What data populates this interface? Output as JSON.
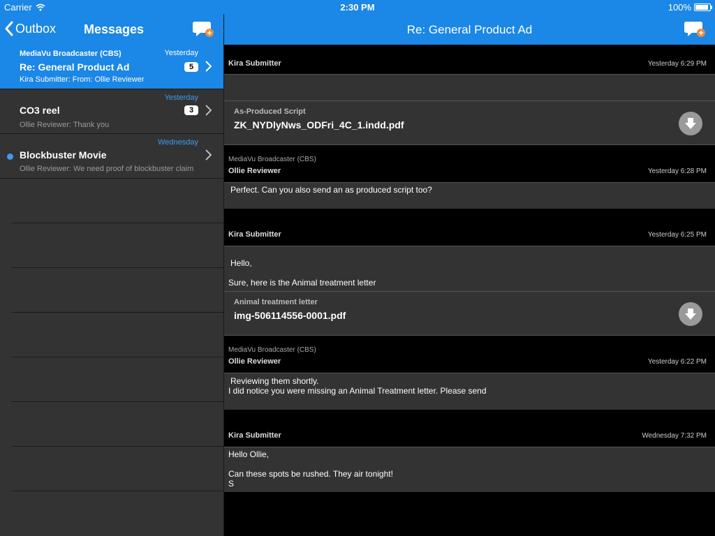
{
  "status_bar": {
    "carrier": "Carrier",
    "time": "2:30 PM",
    "battery": "100%",
    "battery_level": 1.0
  },
  "sidebar": {
    "back_label": "Outbox",
    "title": "Messages",
    "messages": [
      {
        "sender": "MediaVu Broadcaster (CBS)",
        "date": "Yesterday",
        "subject": "Re: General Product Ad",
        "badge": "5",
        "preview": "Kira Submitter: From:    Ollie Reviewer",
        "selected": true,
        "unread": false
      },
      {
        "sender": "",
        "date": "Yesterday",
        "subject": "CO3 reel",
        "badge": "3",
        "preview": "Ollie Reviewer: Thank you",
        "selected": false,
        "unread": false
      },
      {
        "sender": "",
        "date": "Wednesday",
        "subject": "Blockbuster Movie",
        "badge": "",
        "preview": "Ollie Reviewer: We need proof of blockbuster claim",
        "selected": false,
        "unread": true
      }
    ]
  },
  "detail": {
    "title": "Re: General Product Ad",
    "thread": {
      "m1": {
        "name": "Kira Submitter",
        "time": "Yesterday 6:29 PM",
        "attachment_title": "As-Produced Script",
        "attachment_file": "ZK_NYDlyNws_ODFri_4C_1.indd.pdf"
      },
      "m2": {
        "org": "MediaVu Broadcaster (CBS)",
        "name": "Ollie Reviewer",
        "time": "Yesterday 6:28 PM",
        "body": "Perfect. Can you also send an as produced script too?"
      },
      "m3": {
        "name": "Kira Submitter",
        "time": "Yesterday 6:25 PM",
        "body_line1": "Hello,",
        "body_line2": "Sure, here is the Animal treatment letter",
        "attachment_title": "Animal treatment letter",
        "attachment_file": "img-506114556-0001.pdf"
      },
      "m4": {
        "org": "MediaVu Broadcaster (CBS)",
        "name": "Ollie Reviewer",
        "time": "Yesterday 6:22 PM",
        "body_line1": "Reviewing them shortly.",
        "body_line2": "I did notice you were missing an Animal Treatment letter. Please send"
      },
      "m5": {
        "name": "Kira Submitter",
        "time": "Wednesday 7:32 PM",
        "body_line1": "Hello Ollie,",
        "body_line2": "Can these spots be rushed. They air tonight!",
        "body_line3": "S"
      }
    }
  },
  "colors": {
    "accent": "#1b87e6",
    "sidebar_bg": "#333333",
    "detail_bg": "#000000",
    "unread_dot": "#3e9bf0"
  },
  "icons": {
    "back": "chevron-left-icon",
    "compose": "compose-message-icon",
    "download": "download-arrow-icon",
    "wifi": "wifi-icon",
    "battery": "battery-icon"
  }
}
